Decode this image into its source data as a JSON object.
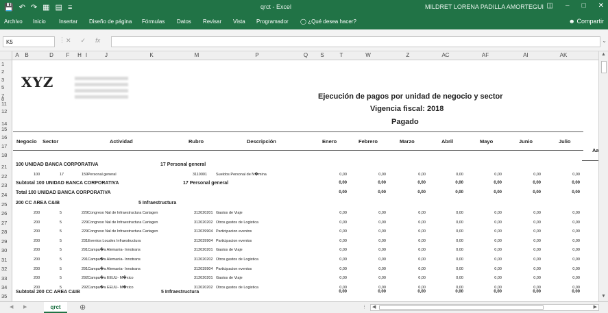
{
  "titlebar": {
    "title": "qrct  -  Excel",
    "user": "MILDRET LORENA PADILLA AMORTEGUI",
    "save_icon": "save-icon",
    "undo_icon": "undo-icon",
    "redo_icon": "redo-icon"
  },
  "ribbon": {
    "tabs": [
      "Archivo",
      "Inicio",
      "Insertar",
      "Diseño de página",
      "Fórmulas",
      "Datos",
      "Revisar",
      "Vista",
      "Programador",
      "¿Qué desea hacer?"
    ],
    "share_label": "Compartir"
  },
  "formula_bar": {
    "name_box": "K5",
    "fx_label": "fx",
    "cancel_glyph": "✕",
    "enter_glyph": "✓",
    "formula": ""
  },
  "columns": [
    "A",
    "B",
    "D",
    "F",
    "H",
    "I",
    "J",
    "K",
    "M",
    "P",
    "Q",
    "S",
    "T",
    "W",
    "Z",
    "AC",
    "AF",
    "AI",
    "AK"
  ],
  "rows": [
    "1",
    "2",
    "3",
    "5",
    "7",
    "8",
    "11",
    "12",
    "14",
    "15",
    "16",
    "17",
    "18",
    "21",
    "22",
    "23",
    "24",
    "25",
    "26",
    "27",
    "28",
    "29",
    "30",
    "31",
    "32",
    "33",
    "34",
    "35"
  ],
  "report": {
    "logo": "XYZ",
    "title": "Ejecución de pagos por unidad de negocio y sector",
    "subtitle": "Vigencia fiscal: 2018",
    "status": "Pagado",
    "headers": [
      "Negocio",
      "Sector",
      "Actividad",
      "Rubro",
      "Descripción",
      "Enero",
      "Febrero",
      "Marzo",
      "Abril",
      "Mayo",
      "Junio",
      "Julio",
      "Aa"
    ],
    "group1": {
      "label": "100  UNIDAD BANCA CORPORATIVA",
      "sector": "17  Personal general",
      "detail": {
        "negocio": "100",
        "sector": "17",
        "act": "159",
        "actividad": "Personal general",
        "rubro": "3110001",
        "descripcion": "Sueldos Personal de N�mina"
      },
      "subtotal_label": "Subtotal  100  UNIDAD BANCA CORPORATIVA",
      "subtotal_sector": "17  Personal general",
      "total_label": "Total  100  UNIDAD BANCA CORPORATIVA"
    },
    "group2": {
      "label": "200  CC AREA C&IB",
      "sector": "5  Infraestructura",
      "details": [
        {
          "negocio": "200",
          "sector": "5",
          "act": "229",
          "actividad": "Congreso Nal de Infraestructura Cartagen",
          "rubro": "312020201",
          "descripcion": "Gastos de Viaje"
        },
        {
          "negocio": "200",
          "sector": "5",
          "act": "229",
          "actividad": "Congreso Nal de Infraestructura Cartagen",
          "rubro": "312020202",
          "descripcion": "Otros gastos de Logistica"
        },
        {
          "negocio": "200",
          "sector": "5",
          "act": "229",
          "actividad": "Congreso Nal de Infraestructura Cartagen",
          "rubro": "312039904",
          "descripcion": "Participacion eventos"
        },
        {
          "negocio": "200",
          "sector": "5",
          "act": "231",
          "actividad": "Eventos Locales Infraestructura",
          "rubro": "312039904",
          "descripcion": "Participacion eventos"
        },
        {
          "negocio": "200",
          "sector": "5",
          "act": "291",
          "actividad": "Campa�a Alemania- Innotrans",
          "rubro": "312020201",
          "descripcion": "Gastos de Viaje"
        },
        {
          "negocio": "200",
          "sector": "5",
          "act": "291",
          "actividad": "Campa�a Alemania- Innotrans",
          "rubro": "312020202",
          "descripcion": "Otros gastos de Logistica"
        },
        {
          "negocio": "200",
          "sector": "5",
          "act": "291",
          "actividad": "Campa�a Alemania- Innotrans",
          "rubro": "312039904",
          "descripcion": "Participacion eventos"
        },
        {
          "negocio": "200",
          "sector": "5",
          "act": "292",
          "actividad": "Campa�a EEUU- M�xico",
          "rubro": "312020201",
          "descripcion": "Gastos de Viaje"
        },
        {
          "negocio": "200",
          "sector": "5",
          "act": "292",
          "actividad": "Campa�a EEUU- M�xico",
          "rubro": "312020202",
          "descripcion": "Otros gastos de Logistica"
        }
      ],
      "subtotal_label": "Subtotal  200  CC AREA C&IB",
      "subtotal_sector": "5  Infraestructura"
    },
    "zero": "0,00"
  },
  "sheet_tab": "qrct",
  "add_sheet": "⊕"
}
